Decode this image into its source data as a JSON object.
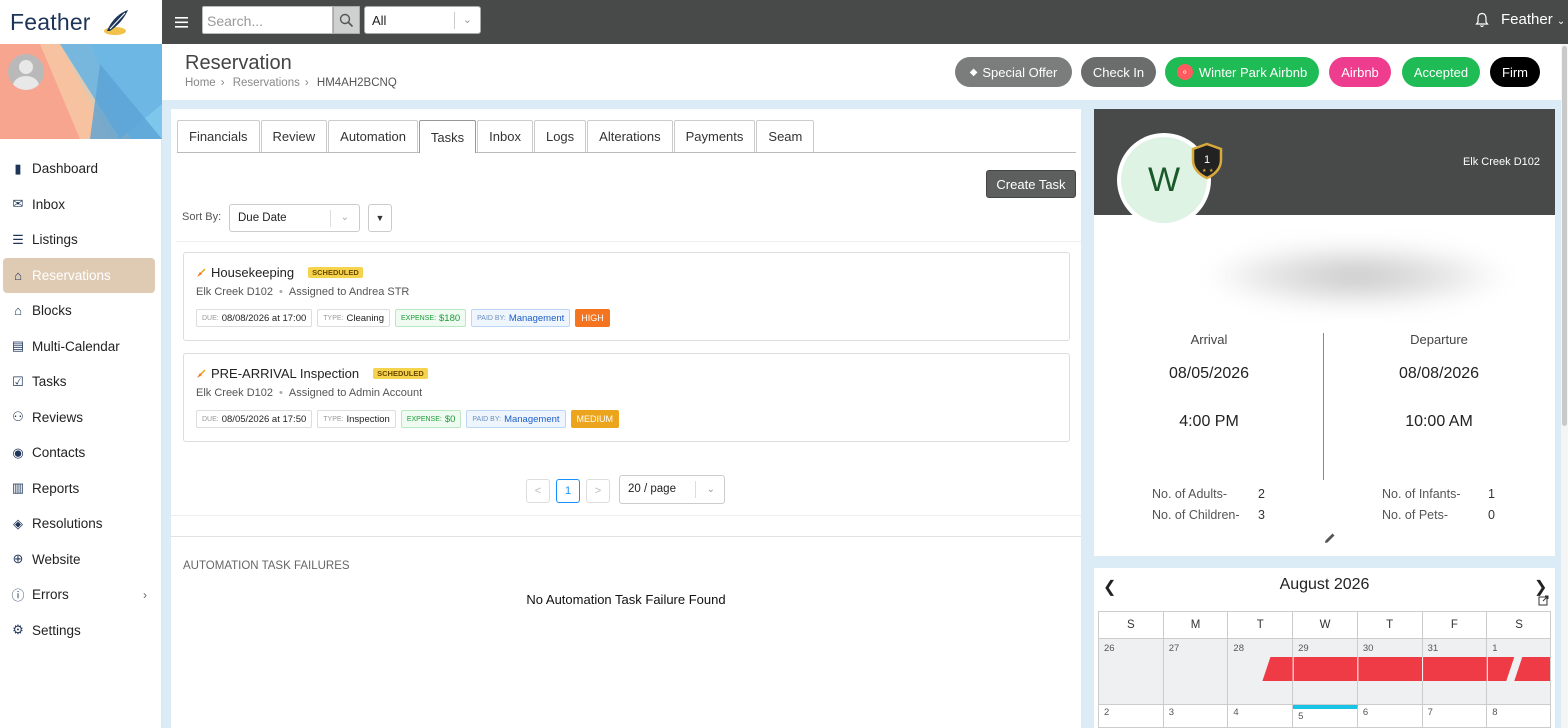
{
  "app": {
    "name": "Feather",
    "user": "Feather"
  },
  "topbar": {
    "search_placeholder": "Search...",
    "filter_value": "All"
  },
  "sidebar": {
    "items": [
      {
        "label": "Dashboard",
        "icon": "bar-chart-icon"
      },
      {
        "label": "Inbox",
        "icon": "envelope-icon"
      },
      {
        "label": "Listings",
        "icon": "list-icon"
      },
      {
        "label": "Reservations",
        "icon": "bell-service-icon",
        "active": true
      },
      {
        "label": "Blocks",
        "icon": "house-clock-icon"
      },
      {
        "label": "Multi-Calendar",
        "icon": "calendar-icon"
      },
      {
        "label": "Tasks",
        "icon": "checklist-icon"
      },
      {
        "label": "Reviews",
        "icon": "people-icon"
      },
      {
        "label": "Contacts",
        "icon": "contact-icon"
      },
      {
        "label": "Reports",
        "icon": "report-icon"
      },
      {
        "label": "Resolutions",
        "icon": "layers-icon"
      },
      {
        "label": "Website",
        "icon": "globe-icon"
      },
      {
        "label": "Errors",
        "icon": "info-circle-icon",
        "has_children": true
      },
      {
        "label": "Settings",
        "icon": "gear-icon"
      }
    ]
  },
  "header": {
    "title": "Reservation",
    "breadcrumb": [
      "Home",
      "Reservations",
      "HM4AH2BCNQ"
    ],
    "pills": [
      {
        "label": "Special Offer",
        "color": "#7a7d7b"
      },
      {
        "label": "Check In",
        "color": "#6a6d6c"
      },
      {
        "label": "Winter Park Airbnb",
        "color": "#1fbb55"
      },
      {
        "label": "Airbnb",
        "color": "#ee3d8e"
      },
      {
        "label": "Accepted",
        "color": "#1fbb55"
      },
      {
        "label": "Firm",
        "color": "#000000"
      }
    ]
  },
  "tabs": [
    "Financials",
    "Review",
    "Automation",
    "Tasks",
    "Inbox",
    "Logs",
    "Alterations",
    "Payments",
    "Seam"
  ],
  "active_tab": "Tasks",
  "tasks_panel": {
    "create_label": "Create Task",
    "sort_label": "Sort By:",
    "sort_value": "Due Date",
    "sort_dir": "▼",
    "tasks": [
      {
        "title": "Housekeeping",
        "status": "SCHEDULED",
        "listing": "Elk Creek D102",
        "assigned": "Assigned to Andrea STR",
        "due_label": "DUE:",
        "due": "08/08/2026 at 17:00",
        "type_label": "TYPE:",
        "type": "Cleaning",
        "expense_label": "EXPENSE:",
        "expense": "$180",
        "paid_label": "PAID BY:",
        "paid": "Management",
        "priority": "HIGH"
      },
      {
        "title": "PRE-ARRIVAL Inspection",
        "status": "SCHEDULED",
        "listing": "Elk Creek D102",
        "assigned": "Assigned to Admin Account",
        "due_label": "DUE:",
        "due": "08/05/2026 at 17:50",
        "type_label": "TYPE:",
        "type": "Inspection",
        "expense_label": "EXPENSE:",
        "expense": "$0",
        "paid_label": "PAID BY:",
        "paid": "Management",
        "priority": "MEDIUM"
      }
    ],
    "pagination": {
      "prev": "<",
      "current": "1",
      "next": ">",
      "page_size": "20 / page"
    },
    "failures_title": "AUTOMATION TASK FAILURES",
    "failures_message": "No Automation Task Failure Found"
  },
  "guest_card": {
    "avatar_letter": "W",
    "badge_number": "1",
    "listing": "Elk Creek D102",
    "arrival_label": "Arrival",
    "arrival_date": "08/05/2026",
    "arrival_time": "4:00 PM",
    "departure_label": "Departure",
    "departure_date": "08/08/2026",
    "departure_time": "10:00 AM",
    "adults_label": "No. of Adults-",
    "adults": "2",
    "children_label": "No. of Children-",
    "children": "3",
    "infants_label": "No. of Infants-",
    "infants": "1",
    "pets_label": "No. of Pets-",
    "pets": "0"
  },
  "calendar": {
    "month": "August 2026",
    "weekdays": [
      "S",
      "M",
      "T",
      "W",
      "T",
      "F",
      "S"
    ],
    "week1": [
      "26",
      "27",
      "28",
      "29",
      "30",
      "31",
      "1"
    ],
    "week2": [
      "2",
      "3",
      "4",
      "5",
      "6",
      "7",
      "8"
    ],
    "booked_color": "#ef3b46",
    "today_color": "#19c3e6"
  }
}
